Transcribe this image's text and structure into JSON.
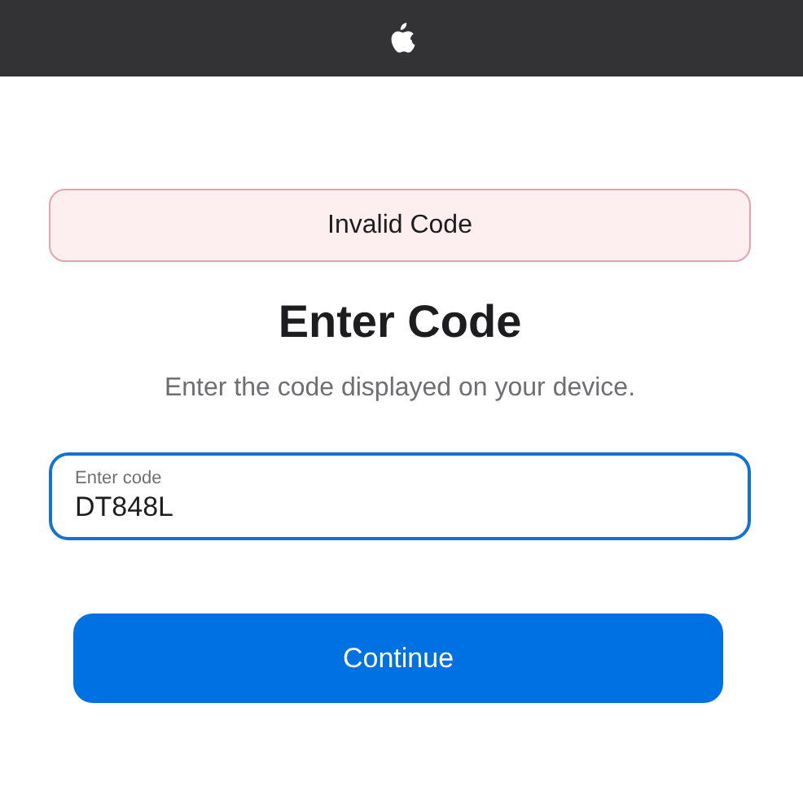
{
  "error_banner": {
    "text": "Invalid Code"
  },
  "title": "Enter Code",
  "subtitle": "Enter the code displayed on your device.",
  "code_field": {
    "label": "Enter code",
    "value": "DT848L",
    "focused": true
  },
  "buttons": [
    {
      "label": "Continue",
      "kind": "primary"
    }
  ]
}
